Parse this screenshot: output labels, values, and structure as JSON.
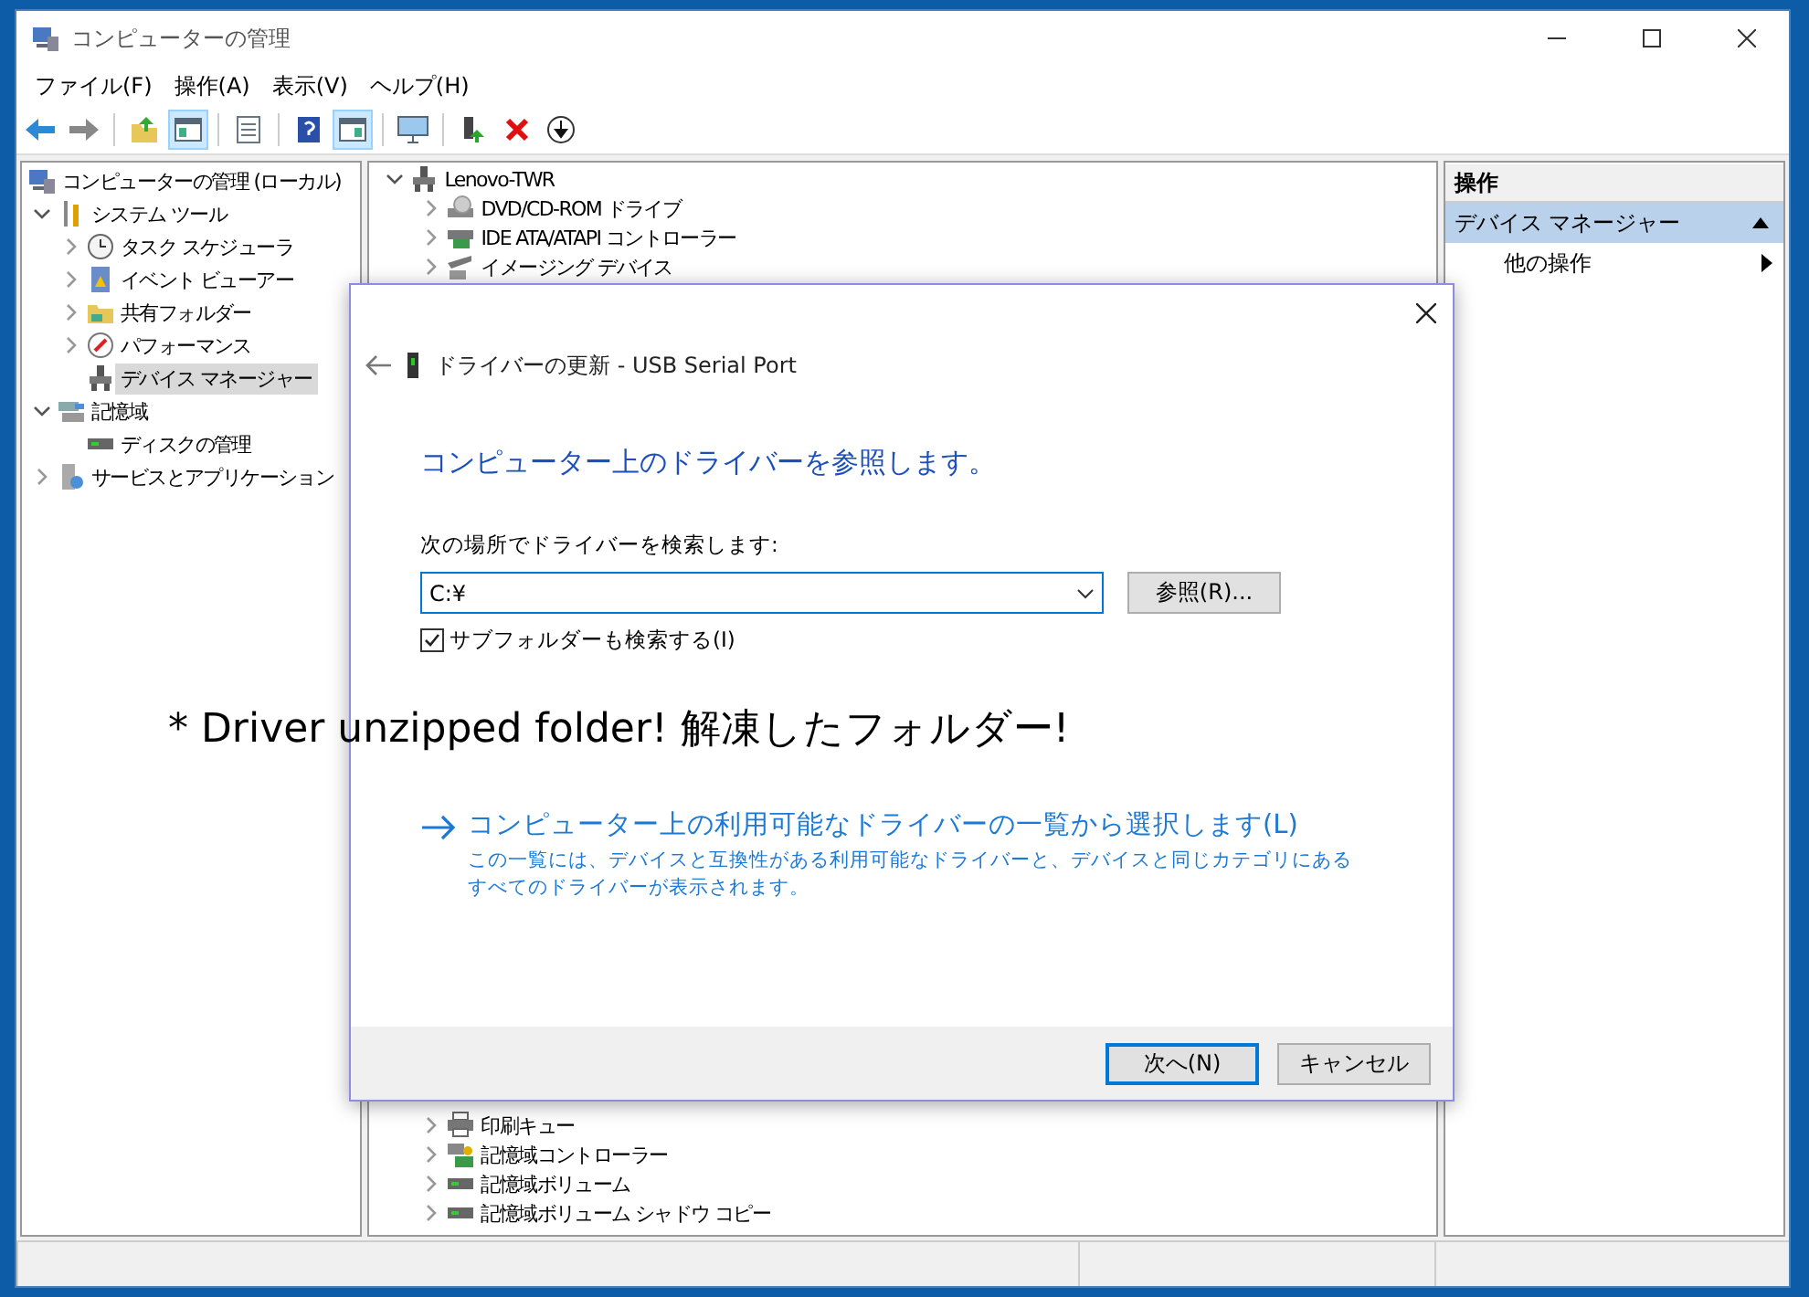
{
  "window": {
    "title": "コンピューターの管理"
  },
  "menu": [
    "ファイル(F)",
    "操作(A)",
    "表示(V)",
    "ヘルプ(H)"
  ],
  "toolbar": [
    {
      "pressed": false
    },
    {
      "pressed": false
    },
    {
      "pressed": false
    },
    {
      "pressed": true
    },
    {
      "pressed": false
    },
    {
      "pressed": false
    },
    {
      "pressed": true
    },
    {
      "pressed": false
    },
    {
      "pressed": false
    },
    {
      "pressed": false
    },
    {
      "pressed": false
    }
  ],
  "console_tree": {
    "items": [
      {
        "label": "コンピューターの管理 (ローカル)",
        "selected": false,
        "children": [
          {
            "label": "システム ツール",
            "expanded": true,
            "selected": false,
            "children": [
              {
                "label": "タスク スケジューラ",
                "expanded": false,
                "selected": false
              },
              {
                "label": "イベント ビューアー",
                "expanded": false,
                "selected": false
              },
              {
                "label": "共有フォルダー",
                "expanded": false,
                "selected": false
              },
              {
                "label": "パフォーマンス",
                "expanded": false,
                "selected": false
              },
              {
                "label": "デバイス マネージャー",
                "selected": true
              }
            ]
          },
          {
            "label": "記憶域",
            "expanded": true,
            "selected": false,
            "children": [
              {
                "label": "ディスクの管理",
                "selected": false
              }
            ]
          },
          {
            "label": "サービスとアプリケーション",
            "expanded": false,
            "selected": false
          }
        ]
      }
    ]
  },
  "device_tree": {
    "root": {
      "label": "Lenovo-TWR",
      "expanded": true
    },
    "children": [
      {
        "label": "DVD/CD-ROM ドライブ",
        "expanded": false
      },
      {
        "label": "IDE ATA/ATAPI コントローラー",
        "expanded": false
      },
      {
        "label": "イメージング デバイス",
        "expanded": false
      },
      {
        "label": "印刷キュー",
        "expanded": false
      },
      {
        "label": "記憶域コントローラー",
        "expanded": false
      },
      {
        "label": "記憶域ボリューム",
        "expanded": false
      },
      {
        "label": "記憶域ボリューム シャドウ コピー",
        "expanded": false
      }
    ]
  },
  "actions_pane": {
    "header": "操作",
    "section": {
      "label": "デバイス マネージャー",
      "expanded": true
    },
    "items": [
      "他の操作"
    ]
  },
  "dialog": {
    "title": "ドライバーの更新 - USB Serial Port",
    "heading": "コンピューター上のドライバーを参照します。",
    "location_label": "次の場所でドライバーを検索します:",
    "location_value": "C:¥",
    "browse_button": "参照(R)...",
    "include_subfolders": {
      "label": "サブフォルダーも検索する(I)",
      "checked": true
    },
    "pick_link": {
      "label": "コンピューター上の利用可能なドライバーの一覧から選択します(L)",
      "description": "この一覧には、デバイスと互換性がある利用可能なドライバーと、デバイスと同じカテゴリにあるすべてのドライバーが表示されます。"
    },
    "buttons": [
      {
        "label": "次へ(N)",
        "default": true
      },
      {
        "label": "キャンセル",
        "default": false
      }
    ]
  },
  "annotation": "* Driver unzipped folder! 解凍したフォルダー!"
}
